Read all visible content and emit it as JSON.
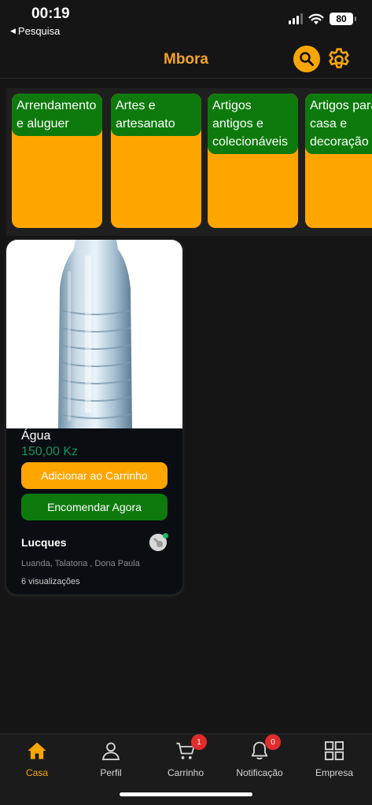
{
  "status_bar": {
    "time": "00:19",
    "back_label": "Pesquisa",
    "battery": "80"
  },
  "header": {
    "title": "Mbora",
    "search_icon": "search-icon",
    "settings_icon": "gear-icon"
  },
  "categories": [
    {
      "label": "Arrendamento e aluguer"
    },
    {
      "label": "Artes e artesanato"
    },
    {
      "label": "Artigos antigos e colecionáveis"
    },
    {
      "label": "Artigos para casa e decoração"
    }
  ],
  "product": {
    "name": "Água",
    "price": "150,00 Kz",
    "add_to_cart": "Adicionar ao Carrinho",
    "order_now": "Encomendar Agora",
    "seller": "Lucques",
    "location": "Luanda, Talatona , Dona Paula",
    "views": "6 visualizações"
  },
  "nav": {
    "items": [
      {
        "label": "Casa",
        "icon": "home-icon",
        "active": true
      },
      {
        "label": "Perfil",
        "icon": "user-icon"
      },
      {
        "label": "Carrinho",
        "icon": "cart-icon",
        "badge": "1"
      },
      {
        "label": "Notificação",
        "icon": "bell-icon",
        "badge": "0"
      },
      {
        "label": "Empresa",
        "icon": "grid-icon"
      }
    ]
  },
  "colors": {
    "accent": "#f9a602",
    "green": "#0e7a0d",
    "price": "#16915c",
    "badge": "#e02c2c",
    "background": "#151515"
  }
}
